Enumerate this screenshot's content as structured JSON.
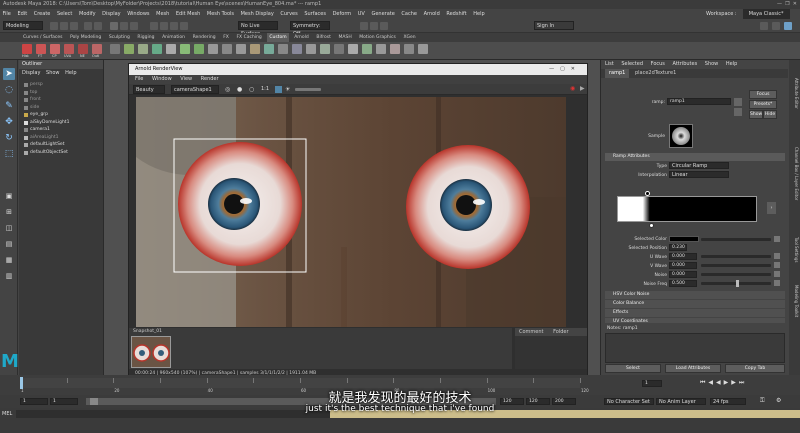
{
  "window": {
    "title": "Autodesk Maya 2018: C:\\Users\\Tom\\Desktop\\MyFolder\\Projects\\2018\\tutorial\\Human Eye\\scenes\\HumanEye_804.ma*   ---   ramp1"
  },
  "menubar": {
    "items": [
      "File",
      "Edit",
      "Create",
      "Select",
      "Modify",
      "Display",
      "Windows",
      "Mesh",
      "Edit Mesh",
      "Mesh Tools",
      "Mesh Display",
      "Curves",
      "Surfaces",
      "Deform",
      "UV",
      "Generate",
      "Cache",
      "Arnold",
      "Redshift",
      "Help"
    ],
    "workspace_label": "Workspace :",
    "workspace_value": "Maya Classic*"
  },
  "statusline": {
    "mode": "Modeling",
    "surface": "No Live Surface",
    "symmetry": "Symmetry: Off",
    "signin": "Sign In"
  },
  "shelf": {
    "tabs": [
      "Curves / Surfaces",
      "Poly Modeling",
      "Sculpting",
      "Rigging",
      "Animation",
      "Rendering",
      "FX",
      "FX Caching",
      "Custom",
      "Arnold",
      "Bifrost",
      "MASH",
      "Motion Graphics",
      "XGen"
    ],
    "active_tab": "Custom",
    "icon_labels": [
      "Hist",
      "FT",
      "CP",
      "UVA",
      "NE",
      "Outl"
    ]
  },
  "outliner": {
    "title": "Outliner",
    "menu": [
      "Display",
      "Show",
      "Help"
    ],
    "items": [
      {
        "label": "persp",
        "dim": true
      },
      {
        "label": "top",
        "dim": true
      },
      {
        "label": "front",
        "dim": true
      },
      {
        "label": "side",
        "dim": true
      },
      {
        "label": "eye_grp",
        "dim": false
      },
      {
        "label": "aiSkyDomeLight1",
        "dim": false
      },
      {
        "label": "camera1",
        "dim": false
      },
      {
        "label": "aiAreaLight1",
        "dim": true
      },
      {
        "label": "defaultLightSet",
        "dim": false
      },
      {
        "label": "defaultObjectSet",
        "dim": false
      }
    ]
  },
  "renderview": {
    "title": "Arnold RenderView",
    "menu": [
      "File",
      "Window",
      "View",
      "Render"
    ],
    "toolbar": {
      "aov": "Beauty",
      "camera": "cameraShape1",
      "ratio": "1:1"
    },
    "snapshot_label": "Snapshot_01",
    "status": "00:00:24 | 960x540 (107%) | cameraShape1 | samples 3/1/1/1/2/2 | 1911.04 MB",
    "comment_tabs": [
      "Comment",
      "Folder"
    ]
  },
  "attribute_editor": {
    "menu": [
      "List",
      "Selected",
      "Focus",
      "Attributes",
      "Show",
      "Help"
    ],
    "tabs": [
      "ramp1",
      "place2dTexture1"
    ],
    "node_label": "ramp:",
    "node_value": "ramp1",
    "focus_btn": "Focus",
    "presets_btn": "Presets*",
    "show_btn": "Show",
    "hide_btn": "Hide",
    "sample_label": "Sample",
    "ramp_section": "Ramp Attributes",
    "type_label": "Type",
    "type_value": "Circular Ramp",
    "interp_label": "Interpolation",
    "interp_value": "Linear",
    "selected_color_label": "Selected Color",
    "selected_position_label": "Selected Position",
    "selected_position_value": "0.230",
    "attrs": [
      {
        "label": "U Wave",
        "value": "0.000"
      },
      {
        "label": "V Wave",
        "value": "0.000"
      },
      {
        "label": "Noise",
        "value": "0.000"
      },
      {
        "label": "Noise Freq",
        "value": "0.500"
      }
    ],
    "closed_sections": [
      "HSV Color Noise",
      "Color Balance",
      "Effects",
      "UV Coordinates"
    ],
    "notes_label": "Notes: ramp1",
    "bottom_buttons": [
      "Select",
      "Load Attributes",
      "Copy Tab"
    ]
  },
  "side_tabs": [
    "Attribute Editor",
    "Channel Box / Layer Editor",
    "Tool Settings",
    "Modeling Toolkit"
  ],
  "timeline": {
    "ticks": [
      "1",
      "",
      "20",
      "",
      "40",
      "",
      "60",
      "",
      "80",
      "",
      "100",
      "",
      "120"
    ],
    "current": "1"
  },
  "range": {
    "start": "1",
    "start2": "1",
    "end": "120",
    "end2": "120",
    "end3": "200",
    "char_set": "No Character Set",
    "anim_layer": "No Anim Layer",
    "fps": "24 fps"
  },
  "cmd": {
    "label": "MEL"
  },
  "subtitle": {
    "chinese": "就是我发现的最好的技术",
    "english": "just it's the best technique that i've found"
  },
  "colors": {
    "accent_blue": "#5285a6",
    "active_tool": "#6ea0c8",
    "shelf_highlight": "#5d5d5d"
  }
}
